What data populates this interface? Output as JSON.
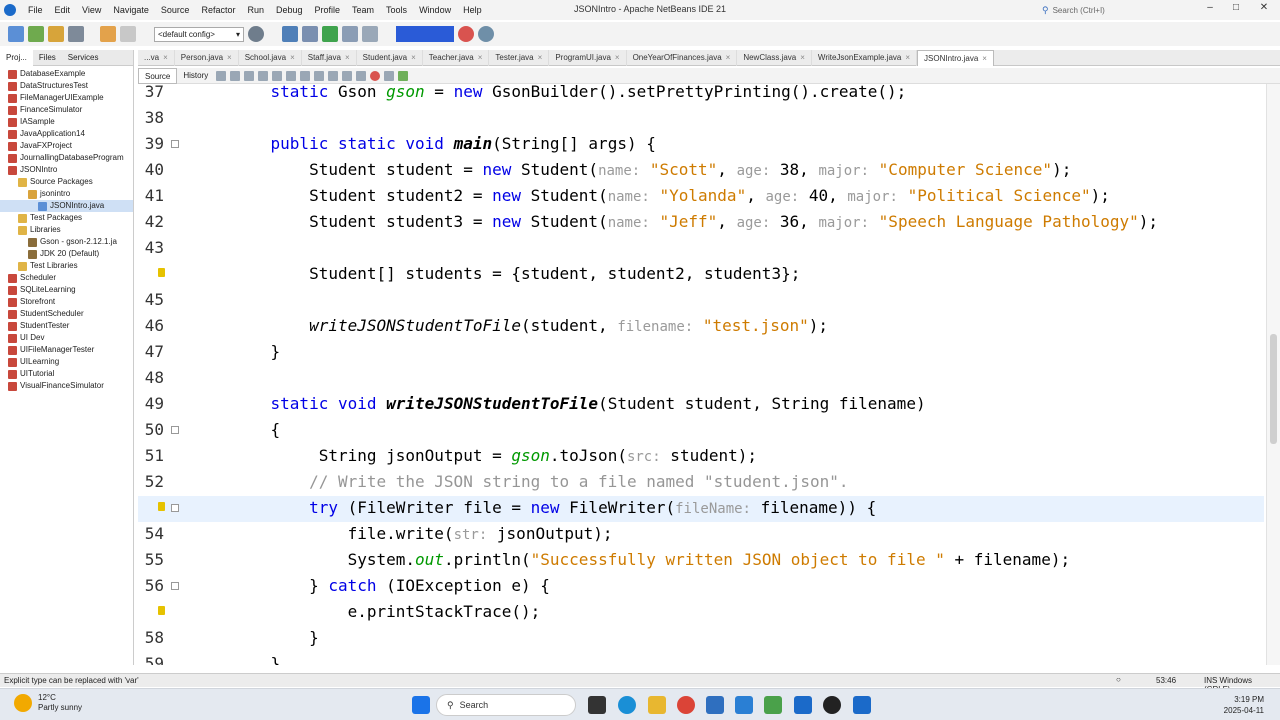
{
  "app": {
    "title": "JSONIntro - Apache NetBeans IDE 21",
    "menu": [
      "File",
      "Edit",
      "View",
      "Navigate",
      "Source",
      "Refactor",
      "Run",
      "Debug",
      "Profile",
      "Team",
      "Tools",
      "Window",
      "Help"
    ],
    "search_placeholder": "Search (Ctrl+I)"
  },
  "toolbar": {
    "config": "<default config>"
  },
  "projects_panel": {
    "tabs": [
      "Proj...",
      "Files",
      "Services"
    ],
    "items": [
      {
        "label": "DatabaseExample",
        "depth": 0,
        "icon": "project-icon"
      },
      {
        "label": "DataStructuresTest",
        "depth": 0,
        "icon": "project-icon"
      },
      {
        "label": "FileManagerUIExample",
        "depth": 0,
        "icon": "project-icon"
      },
      {
        "label": "FinanceSimulator",
        "depth": 0,
        "icon": "project-icon"
      },
      {
        "label": "IASample",
        "depth": 0,
        "icon": "project-icon"
      },
      {
        "label": "JavaApplication14",
        "depth": 0,
        "icon": "project-icon"
      },
      {
        "label": "JavaFXProject",
        "depth": 0,
        "icon": "project-icon"
      },
      {
        "label": "JournallingDatabaseProgram",
        "depth": 0,
        "icon": "project-icon"
      },
      {
        "label": "JSONIntro",
        "depth": 0,
        "icon": "project-icon"
      },
      {
        "label": "Source Packages",
        "depth": 1,
        "icon": "folder-icon"
      },
      {
        "label": "jsonintro",
        "depth": 2,
        "icon": "package-icon"
      },
      {
        "label": "JSONIntro.java",
        "depth": 3,
        "icon": "java-file-icon",
        "selected": true
      },
      {
        "label": "Test Packages",
        "depth": 1,
        "icon": "folder-icon"
      },
      {
        "label": "Libraries",
        "depth": 1,
        "icon": "folder-icon"
      },
      {
        "label": "Gson - gson-2.12.1.ja",
        "depth": 2,
        "icon": "jar-icon"
      },
      {
        "label": "JDK 20 (Default)",
        "depth": 2,
        "icon": "jar-icon"
      },
      {
        "label": "Test Libraries",
        "depth": 1,
        "icon": "folder-icon"
      },
      {
        "label": "Scheduler",
        "depth": 0,
        "icon": "project-icon"
      },
      {
        "label": "SQLiteLearning",
        "depth": 0,
        "icon": "project-icon"
      },
      {
        "label": "Storefront",
        "depth": 0,
        "icon": "project-icon"
      },
      {
        "label": "StudentScheduler",
        "depth": 0,
        "icon": "project-icon"
      },
      {
        "label": "StudentTester",
        "depth": 0,
        "icon": "project-icon"
      },
      {
        "label": "UI Dev",
        "depth": 0,
        "icon": "project-icon"
      },
      {
        "label": "UIFileManagerTester",
        "depth": 0,
        "icon": "project-icon"
      },
      {
        "label": "UILearning",
        "depth": 0,
        "icon": "project-icon"
      },
      {
        "label": "UITutorial",
        "depth": 0,
        "icon": "project-icon"
      },
      {
        "label": "VisualFinanceSimulator",
        "depth": 0,
        "icon": "project-icon"
      }
    ]
  },
  "editor_tabs": [
    {
      "label": "...va",
      "active": false
    },
    {
      "label": "Person.java",
      "active": false
    },
    {
      "label": "School.java",
      "active": false
    },
    {
      "label": "Staff.java",
      "active": false
    },
    {
      "label": "Student.java",
      "active": false
    },
    {
      "label": "Teacher.java",
      "active": false
    },
    {
      "label": "Tester.java",
      "active": false
    },
    {
      "label": "ProgramUI.java",
      "active": false
    },
    {
      "label": "OneYearOfFinances.java",
      "active": false
    },
    {
      "label": "NewClass.java",
      "active": false
    },
    {
      "label": "WriteJsonExample.java",
      "active": false
    },
    {
      "label": "JSONIntro.java",
      "active": true
    }
  ],
  "editor_subbar": {
    "source_label": "Source",
    "history_label": "History"
  },
  "code_lines": [
    {
      "n": "37",
      "html": "    <span class=\"kw\">static</span> Gson <span class=\"fld\">gson</span> = <span class=\"kw\">new</span> GsonBuilder().setPrettyPrinting().create();"
    },
    {
      "n": "38",
      "html": ""
    },
    {
      "n": "39",
      "html": "    <span class=\"kw\">public static void</span> <span class=\"meth\">main</span>(String[] args) {",
      "fold": true
    },
    {
      "n": "40",
      "html": "        Student student = <span class=\"kw\">new</span> Student(<span class=\"hint\">name:</span> <span class=\"str\">\"Scott\"</span>, <span class=\"hint\">age:</span> 38, <span class=\"hint\">major:</span> <span class=\"str\">\"Computer Science\"</span>);"
    },
    {
      "n": "41",
      "html": "        Student student2 = <span class=\"kw\">new</span> Student(<span class=\"hint\">name:</span> <span class=\"str\">\"Yolanda\"</span>, <span class=\"hint\">age:</span> 40, <span class=\"hint\">major:</span> <span class=\"str\">\"Political Science\"</span>);"
    },
    {
      "n": "42",
      "html": "        Student student3 = <span class=\"kw\">new</span> Student(<span class=\"hint\">name:</span> <span class=\"str\">\"Jeff\"</span>, <span class=\"hint\">age:</span> 36, <span class=\"hint\">major:</span> <span class=\"str\">\"Speech Language Pathology\"</span>);"
    },
    {
      "n": "43",
      "html": ""
    },
    {
      "n": "",
      "html": "        Student[] students = {student, student2, student3};",
      "hint_mark": true
    },
    {
      "n": "45",
      "html": ""
    },
    {
      "n": "46",
      "html": "        <span class=\"itl\">writeJSONStudentToFile</span>(student, <span class=\"hint\">filename:</span> <span class=\"str\">\"test.json\"</span>);"
    },
    {
      "n": "47",
      "html": "    }"
    },
    {
      "n": "48",
      "html": ""
    },
    {
      "n": "49",
      "html": "    <span class=\"kw\">static void</span> <span class=\"meth\">writeJSONStudentToFile</span>(Student student, String filename)"
    },
    {
      "n": "50",
      "html": "    {",
      "fold": true
    },
    {
      "n": "51",
      "html": "         String jsonOutput = <span class=\"fld\">gson</span>.toJson(<span class=\"hint\">src:</span> student);"
    },
    {
      "n": "52",
      "html": "        <span class=\"cmt\">// Write the JSON string to a file named \"student.json\".</span>"
    },
    {
      "n": "",
      "html": "        <span class=\"kw\">try</span> (FileWriter file = <span class=\"kw\">new</span> FileWriter(<span class=\"hint\">fileName:</span> filename)) {",
      "current": true,
      "hint_mark": true,
      "fold": true
    },
    {
      "n": "54",
      "html": "            file.write(<span class=\"hint\">str:</span> jsonOutput);"
    },
    {
      "n": "55",
      "html": "            System.<span class=\"fld\">out</span>.println(<span class=\"str\">\"Successfully written JSON object to file \"</span> + filename);"
    },
    {
      "n": "56",
      "html": "        } <span class=\"kw\">catch</span> (IOException e) {",
      "fold": true
    },
    {
      "n": "",
      "html": "            e.printStackTrace();",
      "hint_mark": true
    },
    {
      "n": "58",
      "html": "        }"
    },
    {
      "n": "59",
      "html": "    }"
    }
  ],
  "status": {
    "message": "Explicit type can be replaced with 'var'",
    "position": "53:46",
    "mode": "INS Windows (CRLF)"
  },
  "taskbar": {
    "temperature": "12°C",
    "weather": "Partly sunny",
    "search_label": "Search",
    "time": "3:19 PM",
    "date": "2025-04-11"
  },
  "colors": {
    "keyword": "#0000e6",
    "field": "#009900",
    "string": "#ce7b00",
    "comment": "#969696",
    "selection": "#cfe0f5",
    "memory_widget": "#2a5bd7"
  }
}
